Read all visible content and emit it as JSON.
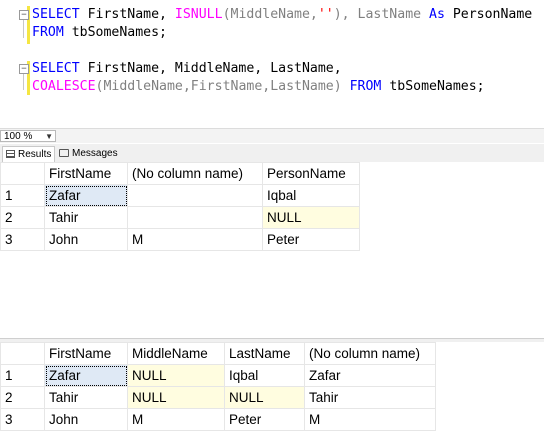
{
  "editor": {
    "query1": {
      "line1": {
        "kw1": "SELECT",
        "t1": " FirstName, ",
        "fn1": "ISNULL",
        "t2": "(MiddleName,",
        "str1": "''",
        "t3": "), LastName ",
        "kw2": "As",
        "t4": " PersonName"
      },
      "line2": {
        "kw1": "FROM",
        "t1": " tbSomeNames;"
      }
    },
    "query2": {
      "line1": {
        "kw1": "SELECT",
        "t1": " FirstName, MiddleName, LastName,"
      },
      "line2": {
        "fn1": "COALESCE",
        "t1": "(MiddleName,FirstName,LastName) ",
        "kw1": "FROM",
        "t2": " tbSomeNames;"
      }
    }
  },
  "zoom": {
    "value": "100 %"
  },
  "tabs": {
    "results": "Results",
    "messages": "Messages"
  },
  "grid1": {
    "columns": [
      "FirstName",
      "(No column name)",
      "PersonName"
    ],
    "rows": [
      {
        "num": "1",
        "cells": [
          "Zafar",
          "",
          "Iqbal"
        ]
      },
      {
        "num": "2",
        "cells": [
          "Tahir",
          "",
          "NULL"
        ]
      },
      {
        "num": "3",
        "cells": [
          "John",
          "M",
          "Peter"
        ]
      }
    ]
  },
  "grid2": {
    "columns": [
      "FirstName",
      "MiddleName",
      "LastName",
      "(No column name)"
    ],
    "rows": [
      {
        "num": "1",
        "cells": [
          "Zafar",
          "NULL",
          "Iqbal",
          "Zafar"
        ]
      },
      {
        "num": "2",
        "cells": [
          "Tahir",
          "NULL",
          "NULL",
          "Tahir"
        ]
      },
      {
        "num": "3",
        "cells": [
          "John",
          "M",
          "Peter",
          "M"
        ]
      }
    ]
  }
}
